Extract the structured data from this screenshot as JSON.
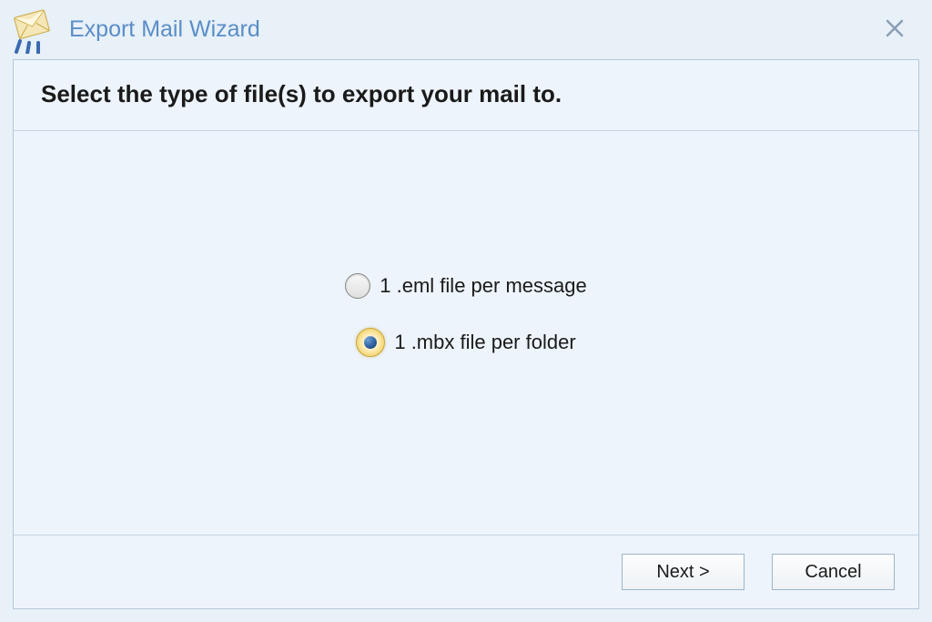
{
  "window": {
    "title": "Export Mail Wizard"
  },
  "page": {
    "title": "Select the type of file(s) to export your mail to."
  },
  "options": {
    "eml": {
      "label": "1 .eml file per message",
      "selected": false
    },
    "mbx": {
      "label": "1 .mbx file per folder",
      "selected": true
    }
  },
  "buttons": {
    "next": "Next >",
    "cancel": "Cancel"
  }
}
